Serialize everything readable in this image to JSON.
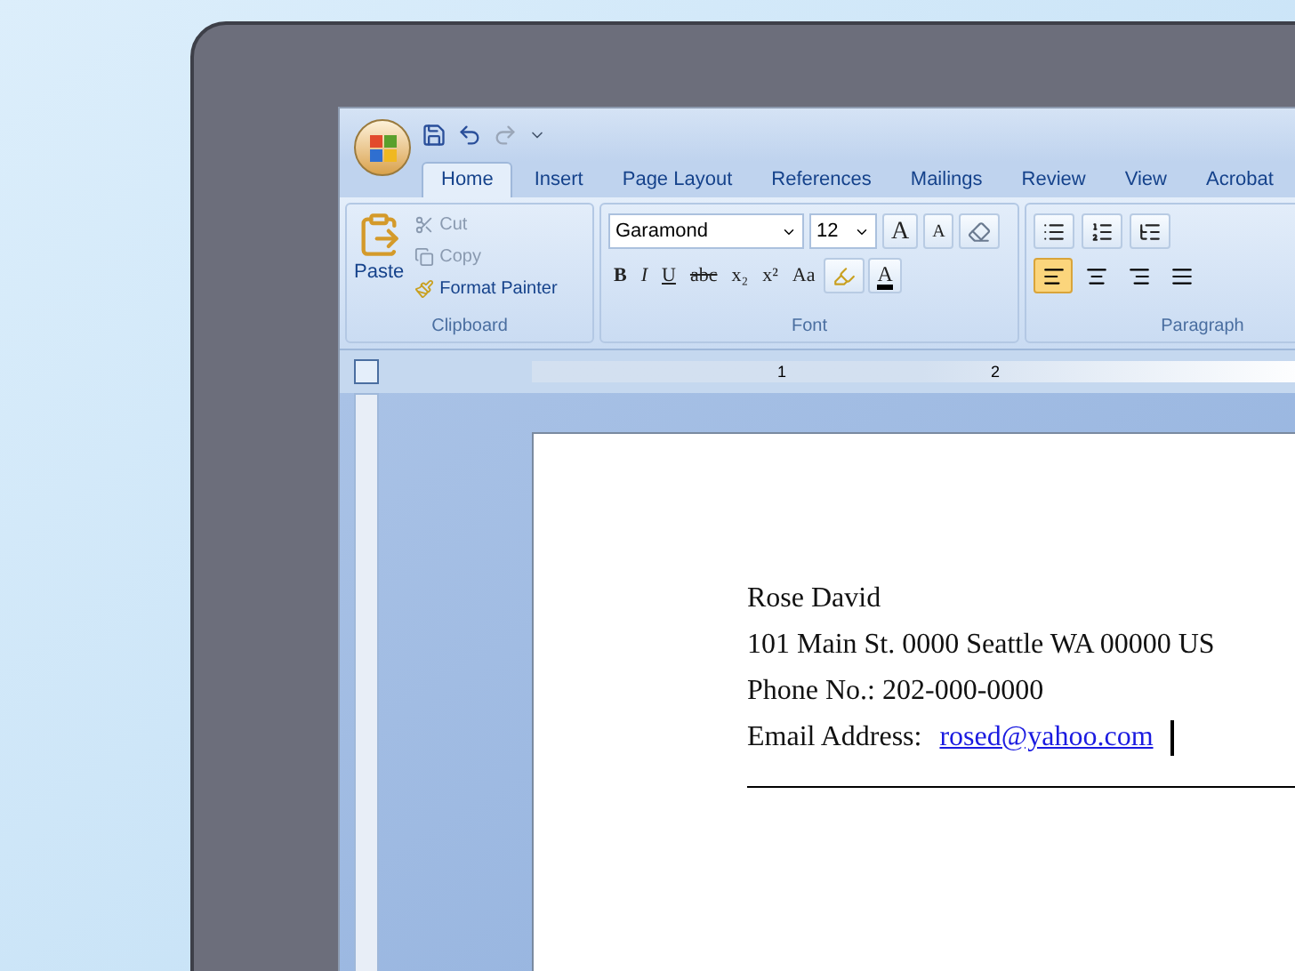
{
  "tabs": [
    {
      "label": "Home",
      "selected": true
    },
    {
      "label": "Insert",
      "selected": false
    },
    {
      "label": "Page Layout",
      "selected": false
    },
    {
      "label": "References",
      "selected": false
    },
    {
      "label": "Mailings",
      "selected": false
    },
    {
      "label": "Review",
      "selected": false
    },
    {
      "label": "View",
      "selected": false
    },
    {
      "label": "Acrobat",
      "selected": false
    }
  ],
  "clipboard": {
    "paste": "Paste",
    "cut": "Cut",
    "copy": "Copy",
    "format_painter": "Format Painter",
    "label": "Clipboard"
  },
  "font": {
    "name": "Garamond",
    "size": "12",
    "label": "Font",
    "format_buttons": [
      "B",
      "I",
      "U",
      "abc",
      "x₂",
      "x²",
      "Aa"
    ],
    "grow_font": "A",
    "shrink_font": "A",
    "font_color": "A"
  },
  "paragraph": {
    "label": "Paragraph",
    "align": [
      {
        "selected": true
      },
      {
        "selected": false
      },
      {
        "selected": false
      },
      {
        "selected": false
      }
    ]
  },
  "ruler": {
    "numbers": [
      "1",
      "2"
    ]
  },
  "document": {
    "lines": [
      "Rose David",
      "101 Main St. 0000 Seattle WA 00000 US",
      "Phone No.:  202-000-0000"
    ],
    "email_label": "Email Address:",
    "email_link": "rosed@yahoo.com"
  }
}
